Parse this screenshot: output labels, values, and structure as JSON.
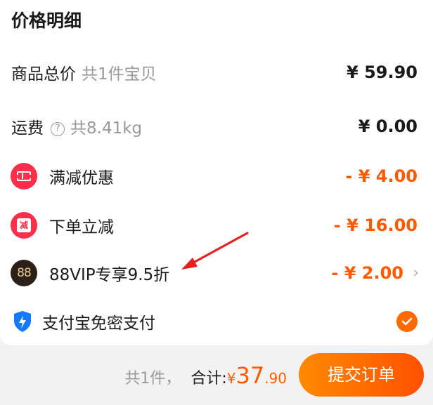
{
  "title": "价格明细",
  "rows": {
    "goods": {
      "label": "商品总价",
      "sub": "共1件宝贝",
      "amount": "¥ 59.90"
    },
    "shipping": {
      "label": "运费",
      "help": "?",
      "sub": "共8.41kg",
      "amount": "¥ 0.00"
    },
    "full_discount": {
      "label": "满减优惠",
      "amount": "- ¥ 4.00",
      "icon": "ticket-icon"
    },
    "order_discount": {
      "label": "下单立减",
      "amount": "- ¥ 16.00",
      "icon": "jian-icon",
      "icon_text": "减"
    },
    "vip": {
      "label": "88VIP专享9.5折",
      "amount": "- ¥ 2.00",
      "icon": "88vip-icon",
      "icon_text": "88",
      "chevron": "›"
    },
    "alipay": {
      "label": "支付宝免密支付",
      "icon": "alipay-shield-icon",
      "checked": true
    }
  },
  "footer": {
    "count": "共1件，",
    "total_label": "合计:",
    "currency": "¥",
    "total_int": "37",
    "total_dec": ".90",
    "submit": "提交订单"
  },
  "colors": {
    "accent": "#ff5a00",
    "red": "#ff2e4a",
    "alipay_blue": "#1677ff"
  }
}
